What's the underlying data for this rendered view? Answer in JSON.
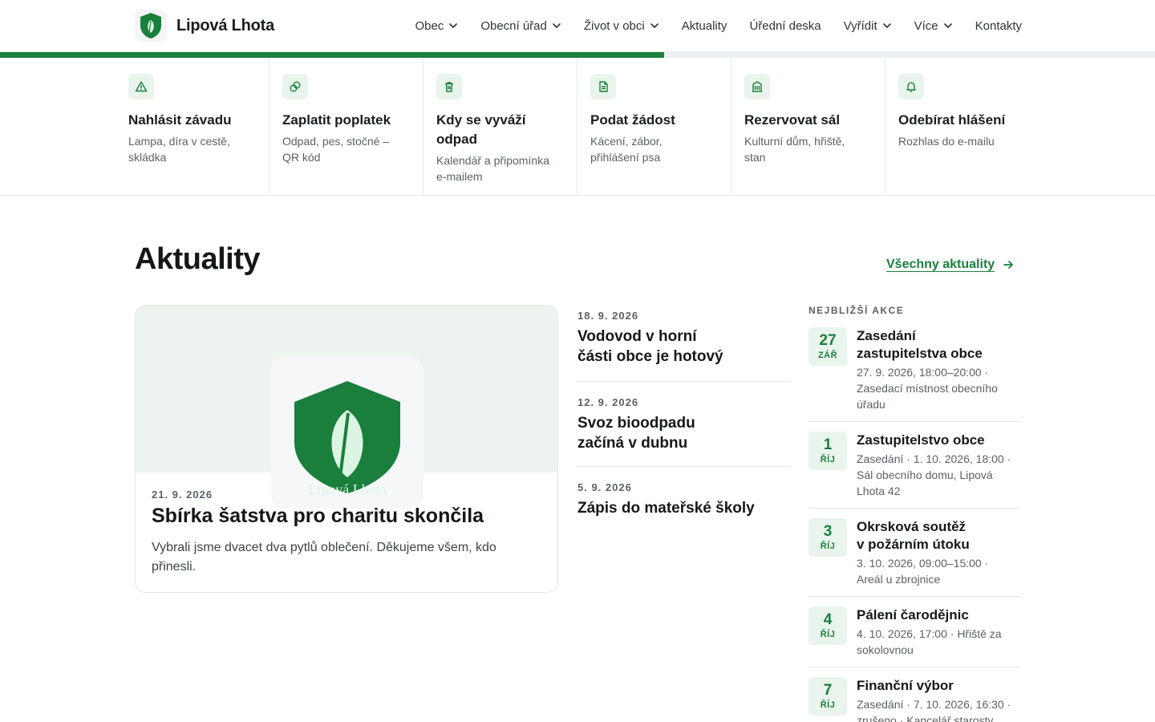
{
  "header": {
    "logo_name": "Lipová Lhota",
    "nav": [
      {
        "label": "Obec",
        "dropdown": true
      },
      {
        "label": "Obecní úřad",
        "dropdown": true
      },
      {
        "label": "Život v obci",
        "dropdown": true
      },
      {
        "label": "Aktuality",
        "dropdown": false
      },
      {
        "label": "Úřední deska",
        "dropdown": false
      },
      {
        "label": "Vyřídit",
        "dropdown": true
      },
      {
        "label": "Více",
        "dropdown": true
      },
      {
        "label": "Kontakty",
        "dropdown": false
      }
    ]
  },
  "progress": {
    "value": 0.575
  },
  "quick_actions": [
    {
      "icon": "warning-triangle-icon",
      "title": "Nahlásit závadu",
      "desc_lines": [
        "Lampa, díra v cestě,",
        "skládka"
      ]
    },
    {
      "icon": "coins-icon",
      "title": "Zaplatit poplatek",
      "desc_lines": [
        "Odpad, pes, stočné –",
        "QR kód"
      ]
    },
    {
      "icon": "trash-icon",
      "title_lines": [
        "Kdy se vyváží",
        "odpad"
      ],
      "desc_lines": [
        "Kalendář a připomínka",
        "e-mailem"
      ]
    },
    {
      "icon": "document-icon",
      "title": "Podat žádost",
      "desc_lines": [
        "Kácení, zábor,",
        "přihlášení psa"
      ]
    },
    {
      "icon": "building-icon",
      "title": "Rezervovat sál",
      "desc_lines": [
        "Kulturní dům, hřiště,",
        "stan"
      ]
    },
    {
      "icon": "bell-icon",
      "title": "Odebírat hlášení",
      "desc_lines": [
        "Rozhlas do e-mailu"
      ]
    }
  ],
  "news": {
    "title": "Aktuality",
    "all_link": "Všechny aktuality",
    "featured": {
      "date": "21. 9. 2026",
      "title": "Sbírka šatstva pro charitu skončila",
      "excerpt": "Vybrali jsme dvacet dva pytlů oblečení. Děkujeme všem, kdo přinesli.",
      "image_caption": "Lipová Lhota"
    },
    "items": [
      {
        "date": "18. 9. 2026",
        "title_lines": [
          "Vodovod v horní",
          "části obce je hotový"
        ]
      },
      {
        "date": "12. 9. 2026",
        "title_lines": [
          "Svoz bioodpadu",
          "začíná v dubnu"
        ]
      },
      {
        "date": "5. 9. 2026",
        "title_lines": [
          "Zápis do mateřské školy"
        ]
      }
    ]
  },
  "events": {
    "heading": "NEJBLIŽŠÍ AKCE",
    "items": [
      {
        "day": "27",
        "month": "ZÁŘ",
        "title_lines": [
          "Zasedání",
          "zastupitelstva obce"
        ],
        "meta_lines": [
          "27. 9. 2026, 18:00–20:00 ·",
          "Zasedací místnost obecního",
          "úřadu"
        ]
      },
      {
        "day": "1",
        "month": "ŘÍJ",
        "title_lines": [
          "Zastupitelstvo obce"
        ],
        "meta_lines": [
          "Zasedání · 1. 10. 2026, 18:00 ·",
          "Sál obecního domu, Lipová",
          "Lhota 42"
        ]
      },
      {
        "day": "3",
        "month": "ŘÍJ",
        "title_lines": [
          "Okrsková soutěž",
          "v požárním útoku"
        ],
        "meta_lines": [
          "3. 10. 2026, 09:00–15:00 ·",
          "Areál u zbrojnice"
        ]
      },
      {
        "day": "4",
        "month": "ŘÍJ",
        "title_lines": [
          "Pálení čarodějnic"
        ],
        "meta_lines": [
          "4. 10. 2026, 17:00 · Hřiště za",
          "sokolovnou"
        ]
      },
      {
        "day": "7",
        "month": "ŘÍJ",
        "title_lines": [
          "Finanční výbor"
        ],
        "meta_lines": [
          "Zasedání · 7. 10. 2026, 16:30 ·",
          "zrušeno · Kancelář starosty"
        ]
      }
    ]
  },
  "colors": {
    "accent": "#1a7f3c",
    "accent_light": "#e9f4ec",
    "text": "#15181a",
    "muted": "#5b6166"
  }
}
